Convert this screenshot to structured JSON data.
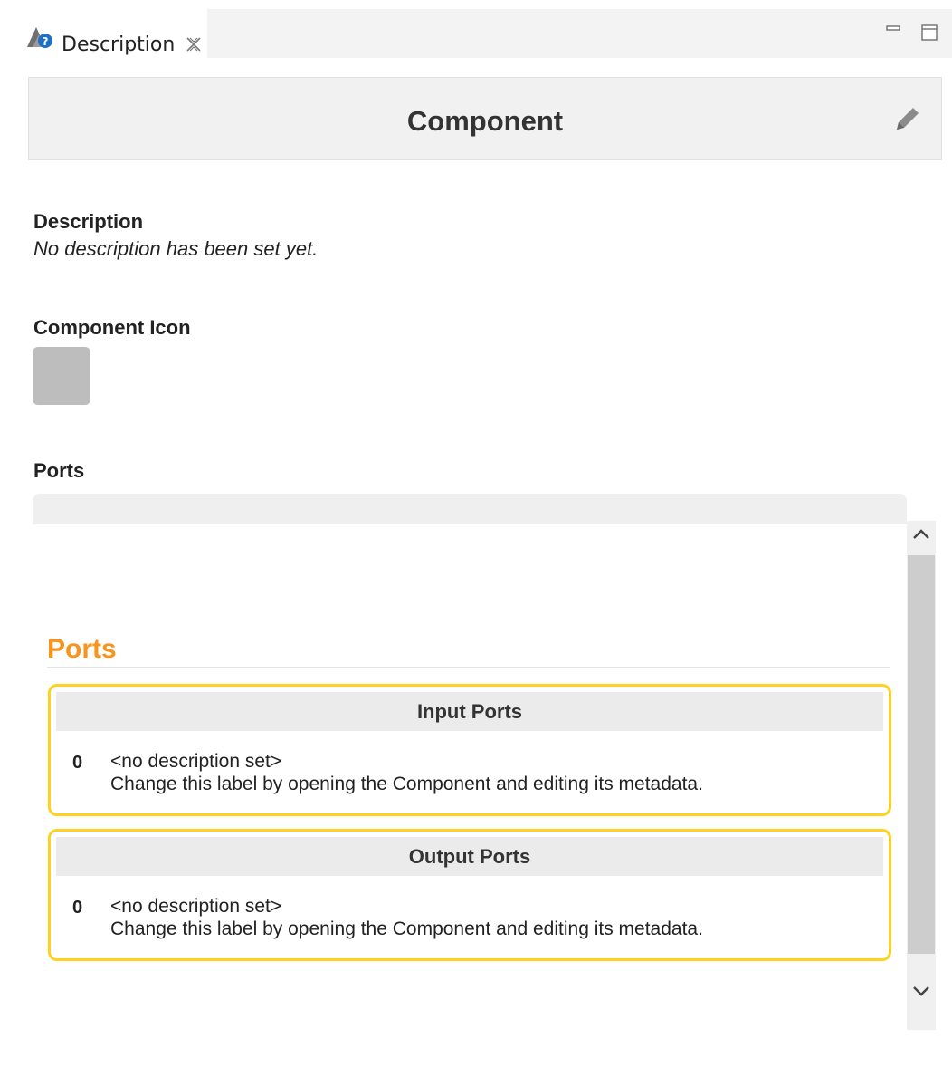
{
  "tab": {
    "label": "Description",
    "icon": "component-help-icon",
    "close_icon": "close-tab-icon"
  },
  "window_controls": {
    "minimize_icon": "minimize-icon",
    "maximize_icon": "maximize-icon"
  },
  "header": {
    "title": "Component",
    "edit_icon": "pencil-icon"
  },
  "description": {
    "label": "Description",
    "text": "No description has been set yet."
  },
  "component_icon": {
    "label": "Component Icon"
  },
  "ports_section": {
    "label": "Ports"
  },
  "ports_panel": {
    "heading": "Ports",
    "heading_color": "#f7941d",
    "box_border_color": "#ffd21f",
    "input_ports": {
      "title": "Input Ports",
      "items": [
        {
          "index": "0",
          "name": "<no description set>",
          "hint": "Change this label by opening the Component and editing its metadata."
        }
      ]
    },
    "output_ports": {
      "title": "Output Ports",
      "items": [
        {
          "index": "0",
          "name": "<no description set>",
          "hint": "Change this label by opening the Component and editing its metadata."
        }
      ]
    }
  }
}
